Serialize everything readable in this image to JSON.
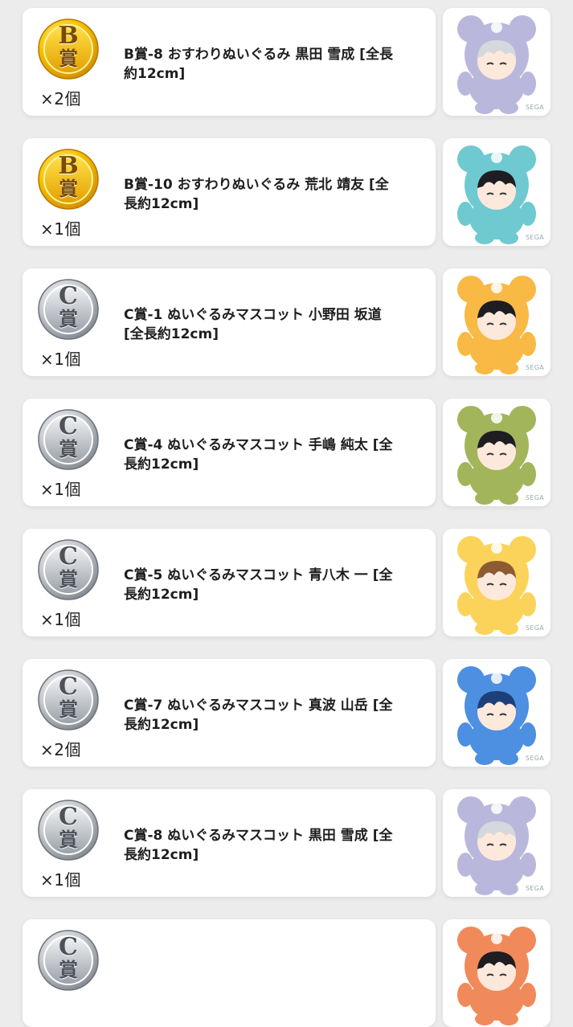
{
  "colors": {
    "page_bg": "#ececec",
    "card_bg": "#ffffff",
    "gold_medal": "#f2c200",
    "silver_medal": "#b8bcc2"
  },
  "items": [
    {
      "medal": "B賞",
      "medal_color": "gold",
      "count": "×2個",
      "title": "B賞-8 おすわりぬいぐるみ 黒田 雪成 [全長約12cm]",
      "image_icon": "lavender-bear-plush-image",
      "plush_color": "#b9b8dc",
      "hair_color": "#d5d8dc",
      "watermark": "SEGA"
    },
    {
      "medal": "B賞",
      "medal_color": "gold",
      "count": "×1個",
      "title": "B賞-10 おすわりぬいぐるみ 荒北 靖友 [全長約12cm]",
      "image_icon": "teal-bear-plush-image",
      "plush_color": "#6fc9d0",
      "hair_color": "#1d1d22",
      "watermark": "SEGA"
    },
    {
      "medal": "C賞",
      "medal_color": "silver",
      "count": "×1個",
      "title": "C賞-1 ぬいぐるみマスコット 小野田 坂道 [全長約12cm]",
      "image_icon": "orange-bear-plush-image",
      "plush_color": "#f8b945",
      "hair_color": "#1d1d22",
      "watermark": "SEGA"
    },
    {
      "medal": "C賞",
      "medal_color": "silver",
      "count": "×1個",
      "title": "C賞-4 ぬいぐるみマスコット 手嶋 純太 [全長約12cm]",
      "image_icon": "green-bear-plush-image",
      "plush_color": "#a3b55b",
      "hair_color": "#1d1d22",
      "watermark": "SEGA"
    },
    {
      "medal": "C賞",
      "medal_color": "silver",
      "count": "×1個",
      "title": "C賞-5 ぬいぐるみマスコット 青八木 一 [全長約12cm]",
      "image_icon": "yellow-bear-plush-image",
      "plush_color": "#fbd35a",
      "hair_color": "#8c5a33",
      "watermark": "SEGA"
    },
    {
      "medal": "C賞",
      "medal_color": "silver",
      "count": "×2個",
      "title": "C賞-7 ぬいぐるみマスコット 真波 山岳 [全長約12cm]",
      "image_icon": "blue-bear-plush-image",
      "plush_color": "#4d8fe0",
      "hair_color": "#1f3f7a",
      "watermark": "SEGA"
    },
    {
      "medal": "C賞",
      "medal_color": "silver",
      "count": "×1個",
      "title": "C賞-8 ぬいぐるみマスコット 黒田 雪成 [全長約12cm]",
      "image_icon": "lavender-bear-plush-image",
      "plush_color": "#b9b8dc",
      "hair_color": "#d5d8dc",
      "watermark": "SEGA"
    },
    {
      "medal": "C賞",
      "medal_color": "silver",
      "count": "",
      "title": "",
      "image_icon": "coral-bear-plush-image",
      "plush_color": "#f08a5a",
      "hair_color": "#1d1d22",
      "watermark": ""
    }
  ]
}
